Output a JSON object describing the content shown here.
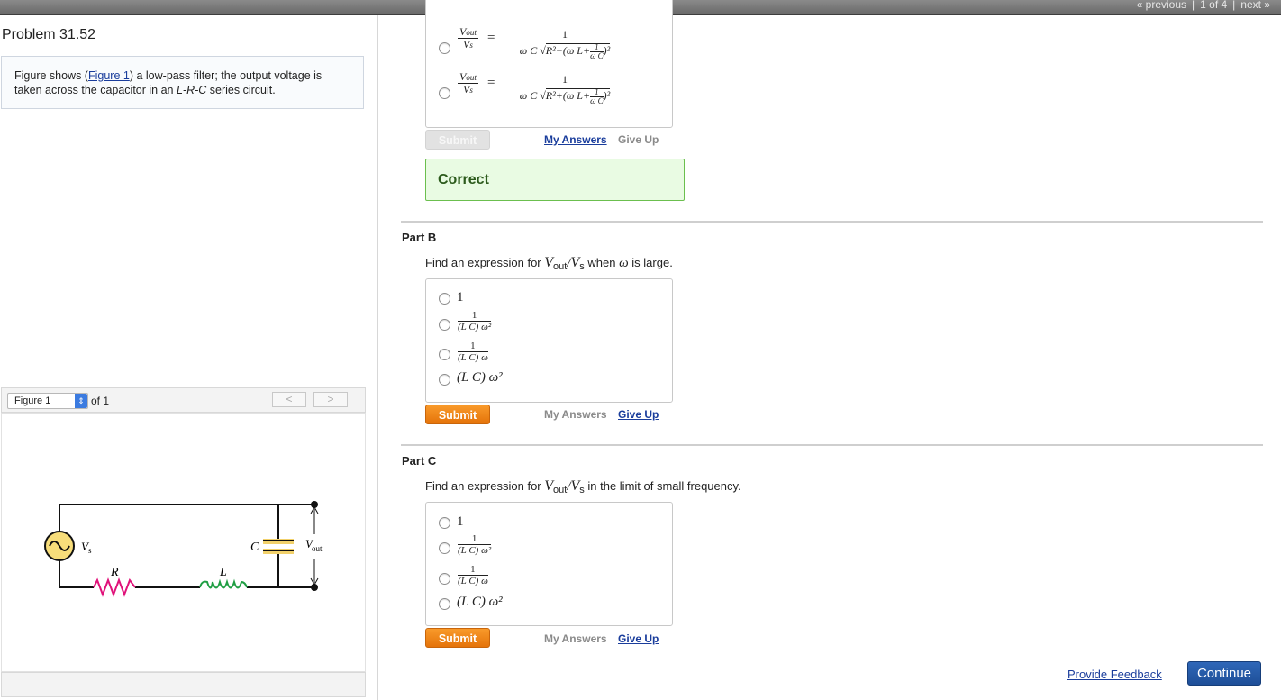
{
  "top_nav": {
    "previous": "« previous",
    "position": "1 of 4",
    "next": "next »"
  },
  "problem": {
    "title": "Problem 31.52",
    "description_pre": "Figure shows (",
    "figure_link": "Figure 1",
    "description_post_1": ") a low-pass filter; the output voltage is taken across the capacitor in an ",
    "description_lrc": "L-R-C",
    "description_post_2": " series circuit."
  },
  "figure_viewer": {
    "selected": "Figure 1",
    "of_label": "of 1",
    "prev": "<",
    "next": ">",
    "circuit": {
      "source": "V",
      "source_sub": "s",
      "r": "R",
      "l": "L",
      "c": "C",
      "out": "V",
      "out_sub": "out"
    }
  },
  "part_a": {
    "fraction_lhs_num": "V",
    "fraction_lhs_num_sub": "out",
    "fraction_lhs_den": "V",
    "fraction_lhs_den_sub": "s",
    "option1": {
      "num": "1",
      "den_prefix": "ω C",
      "den_radicand": "R²−(ω L+",
      "inner_num": "1",
      "inner_den": "ω C",
      "close": ")²"
    },
    "option2": {
      "num": "1",
      "den_prefix": "ω C",
      "den_radicand": "R²+(ω L+",
      "inner_num": "1",
      "inner_den": "ω C",
      "close": ")²"
    },
    "submit": "Submit",
    "my_answers": "My Answers",
    "give_up": "Give Up",
    "result": "Correct"
  },
  "part_b": {
    "title": "Part B",
    "question_pre": "Find an expression for ",
    "question_var": "V",
    "question_sub1": "out",
    "question_slash": "/",
    "question_var2": "V",
    "question_sub2": "s",
    "question_when": " when ",
    "question_omega": "ω",
    "question_post": " is large.",
    "options": [
      {
        "text": "1"
      },
      {
        "num": "1",
        "den": "(L C) ω²"
      },
      {
        "num": "1",
        "den": "(L C) ω"
      },
      {
        "text": "(L C) ω²"
      }
    ],
    "submit": "Submit",
    "my_answers": "My Answers",
    "give_up": "Give Up"
  },
  "part_c": {
    "title": "Part C",
    "question_pre": "Find an expression for ",
    "question_var": "V",
    "question_sub1": "out",
    "question_slash": "/",
    "question_var2": "V",
    "question_sub2": "s",
    "question_post": " in the limit of small frequency.",
    "options": [
      {
        "text": "1"
      },
      {
        "num": "1",
        "den": "(L C) ω²"
      },
      {
        "num": "1",
        "den": "(L C) ω"
      },
      {
        "text": "(L C) ω²"
      }
    ],
    "submit": "Submit",
    "my_answers": "My Answers",
    "give_up": "Give Up"
  },
  "footer": {
    "feedback": "Provide Feedback",
    "continue": "Continue"
  },
  "colors": {
    "accent_orange": "#f28a1a",
    "link_blue": "#1a3d9c",
    "correct_green": "#6bbf4e",
    "continue_blue": "#2a5fae"
  }
}
